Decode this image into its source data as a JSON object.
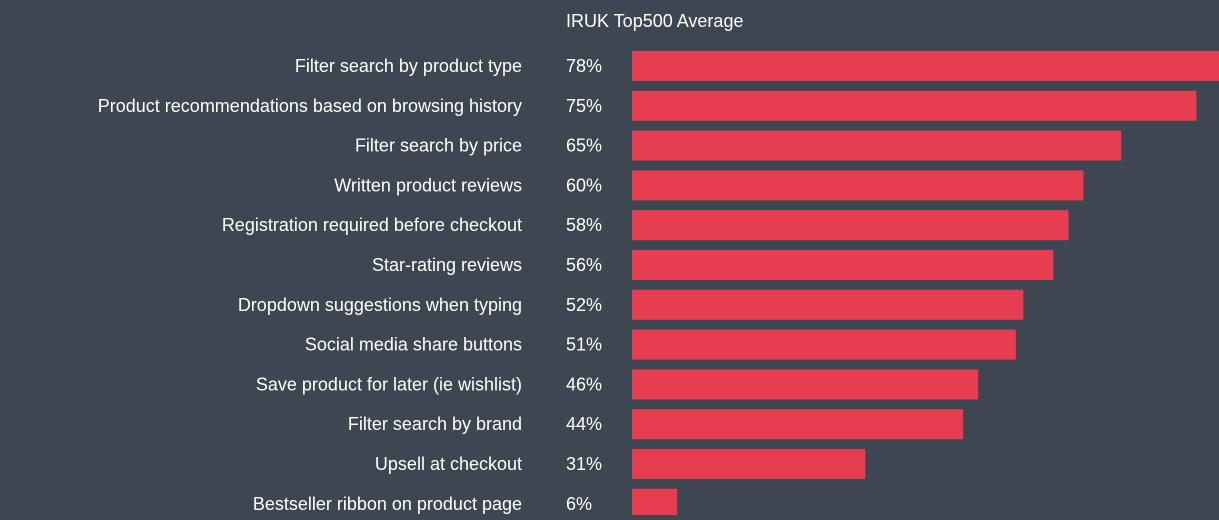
{
  "colors": {
    "background": "#3e4652",
    "bar": "#e63d50",
    "text": "#ffffff"
  },
  "chart_data": {
    "type": "bar",
    "orientation": "horizontal",
    "title": "IRUK Top500 Average",
    "xlabel": "",
    "ylabel": "",
    "xlim": [
      0,
      78
    ],
    "grid": false,
    "legend": "none",
    "value_suffix": "%",
    "categories": [
      "Filter search by product type",
      "Product recommendations based on browsing history",
      "Filter search by price",
      "Written product reviews",
      "Registration required before checkout",
      "Star-rating reviews",
      "Dropdown suggestions when typing",
      "Social media share buttons",
      "Save product for later (ie wishlist)",
      "Filter search by brand",
      "Upsell at checkout",
      "Bestseller ribbon on product page"
    ],
    "values": [
      78,
      75,
      65,
      60,
      58,
      56,
      52,
      51,
      46,
      44,
      31,
      6
    ]
  }
}
